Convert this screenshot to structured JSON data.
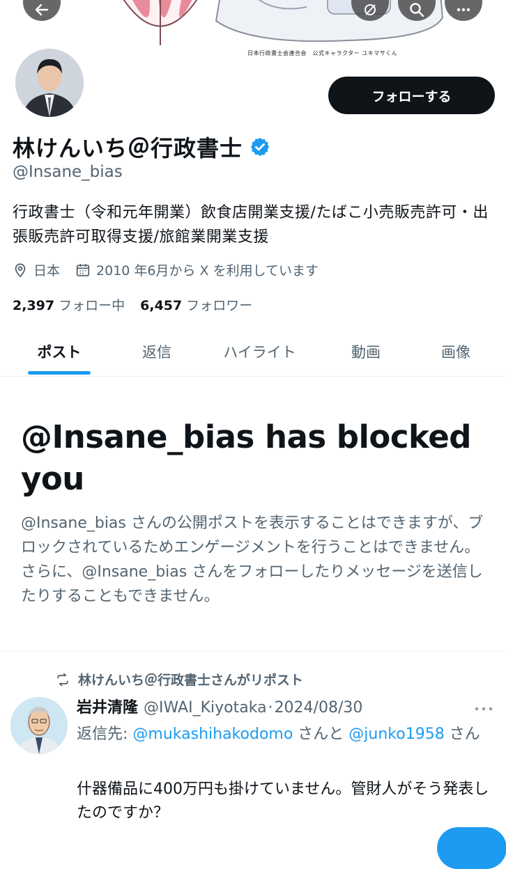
{
  "banner": {
    "caption": "日本行政書士会連合会　公式キャラクター ユキマサくん"
  },
  "profile": {
    "display_name": "林けんいち＠行政書士",
    "handle": "@Insane_bias",
    "bio": "行政書士（令和元年開業）飲食店開業支援/たばこ小売販売許可・出張販売許可取得支援/旅館業開業支援",
    "location": "日本",
    "joined": "2010 年6月から X を利用しています",
    "following_count": "2,397",
    "following_label": "フォロー中",
    "followers_count": "6,457",
    "followers_label": "フォロワー",
    "follow_button": "フォローする"
  },
  "tabs": [
    "ポスト",
    "返信",
    "ハイライト",
    "動画",
    "画像"
  ],
  "blocked": {
    "title": "@Insane_bias has blocked you",
    "description": "@Insane_bias さんの公開ポストを表示することはできますが、ブロックされているためエンゲージメントを行うことはできません。さらに、@Insane_bias さんをフォローしたりメッセージを送信したりすることもできません。"
  },
  "tweet": {
    "repost_label": "林けんいち＠行政書士さんがリポスト",
    "author_name": "岩井清隆",
    "author_handle": "@IWAI_Kiyotaka",
    "separator": "·",
    "date": "2024/08/30",
    "reply_prefix": "返信先: ",
    "reply_user1": "@mukashihakodomo",
    "reply_mid": " さんと ",
    "reply_user2": "@junko1958",
    "reply_suffix": " さん",
    "text": "什器備品に400万円も掛けていません。管財人がそう発表したのですか？"
  },
  "colors": {
    "accent": "#1d9bf0",
    "text_primary": "#0f1419",
    "text_secondary": "#536471",
    "button_dark": "#0f1419"
  },
  "icons": [
    "back-arrow-icon",
    "grok-icon",
    "search-icon",
    "more-icon",
    "verified-badge-icon",
    "location-pin-icon",
    "calendar-icon",
    "repost-icon",
    "tweet-more-icon"
  ]
}
